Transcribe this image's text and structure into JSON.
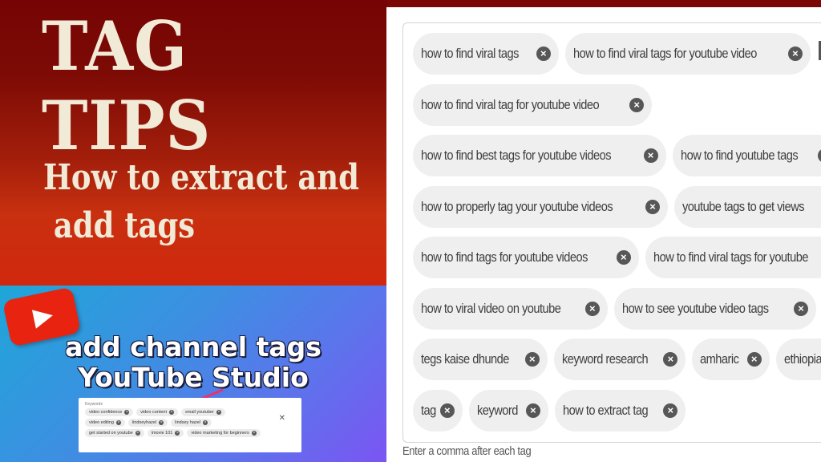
{
  "banner": {
    "title": "TAG TIPS",
    "subtitle": "How to extract and\n add tags"
  },
  "promo": {
    "logo_icon": "youtube-play-icon",
    "line1": "add channel tags",
    "line2": "YouTube Studio",
    "mini_panel": {
      "label": "Keywords",
      "rows": [
        [
          "video confidence",
          "video content",
          "small youtuber"
        ],
        [
          "video editing",
          "lindseyhazel",
          "lindsey hazel"
        ],
        [
          "get started on youtube",
          "imovie 101",
          "video marketing for beginners"
        ]
      ],
      "close_icon": "close-icon"
    },
    "arrow_color": "#ee2f6f"
  },
  "tags_panel": {
    "rows": [
      [
        "how to find viral tags",
        "how to find viral tags for youtube video"
      ],
      [
        "how to find viral tag for youtube video"
      ],
      [
        "how to find best tags for youtube videos",
        "how to find youtube tags"
      ],
      [
        "how to properly tag your youtube videos",
        "youtube tags to get views"
      ],
      [
        "how to find tags for youtube videos",
        "how to find viral tags for youtube"
      ],
      [
        "how to viral video on youtube",
        "how to see youtube video tags"
      ],
      [
        "tegs kaise dhunde",
        "keyword research",
        "amharic",
        "ethiopian"
      ],
      [
        "tag",
        "keyword",
        "how to extract tag"
      ]
    ],
    "remove_icon": "remove-tag-icon",
    "remove_glyph": "×",
    "helper_text": "Enter a comma after each tag"
  },
  "colors": {
    "banner_text": "#f1ead7",
    "banner_red_dark": "#760404",
    "banner_red_light": "#d1280d",
    "chip_bg": "#efefef",
    "chip_x": "#575757"
  }
}
